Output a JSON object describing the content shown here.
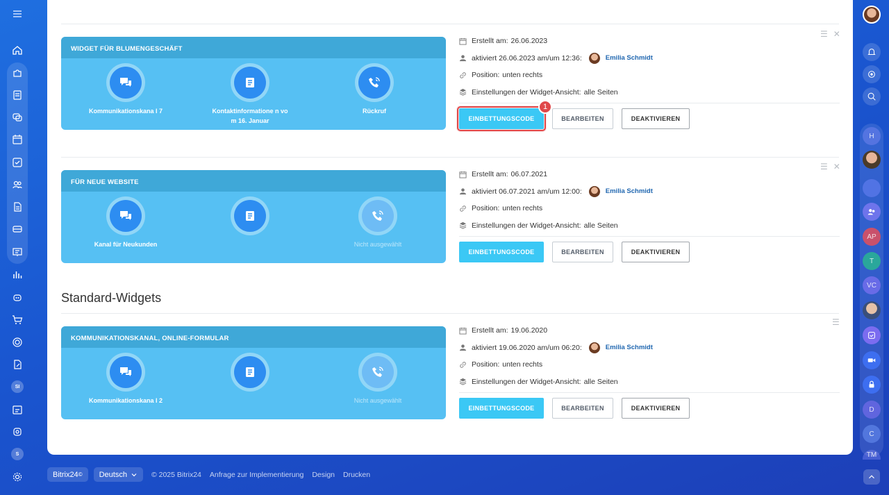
{
  "sidebar": {
    "icons": [
      "menu-icon",
      "home-icon",
      "puzzle-icon",
      "feed-icon",
      "chat-icon",
      "calendar-icon",
      "tasks-icon",
      "contacts-icon",
      "documents-icon",
      "inbox-icon",
      "presentation-icon",
      "analytics-icon",
      "robot-icon",
      "cart-icon",
      "target-icon",
      "edit-doc-icon"
    ],
    "badge_si": "SI",
    "badge_s": "S",
    "icons_bottom": [
      "calendar-list-icon",
      "support-icon",
      "settings-icon"
    ]
  },
  "rightbar": {
    "letters": [
      "H",
      "AP",
      "T",
      "VC",
      "D",
      "C",
      "TM"
    ]
  },
  "widgets": [
    {
      "title": "WIDGET FÜR BLUMENGESCHÄFT",
      "channels": [
        {
          "label": "Kommunikationskana l 7",
          "icon": "chat-icon",
          "active": true
        },
        {
          "label": "Kontaktinformatione n vom 16. Januar",
          "icon": "form-icon",
          "active": true
        },
        {
          "label": "Rückruf",
          "icon": "phone-icon",
          "active": true
        }
      ],
      "created_label": "Erstellt am:",
      "created": "26.06.2023",
      "activated_label": "aktiviert 26.06.2023 am/um 12:36:",
      "user": "Emilia Schmidt",
      "position_label": "Position:",
      "position": "unten rechts",
      "settings_label": "Einstellungen der Widget-Ansicht:",
      "settings": "alle Seiten",
      "btn_embed": "EINBETTUNGSCODE",
      "btn_edit": "BEARBEITEN",
      "btn_deactivate": "DEAKTIVIEREN",
      "callout": "1"
    },
    {
      "title": "FÜR NEUE WEBSITE",
      "channels": [
        {
          "label": "Kanal für Neukunden",
          "icon": "chat-icon",
          "active": true
        },
        {
          "label": "",
          "icon": "form-icon",
          "active": true
        },
        {
          "label": "Nicht ausgewählt",
          "icon": "phone-icon",
          "active": false
        }
      ],
      "created_label": "Erstellt am:",
      "created": "06.07.2021",
      "activated_label": "aktiviert 06.07.2021 am/um 12:00:",
      "user": "Emilia Schmidt",
      "position_label": "Position:",
      "position": "unten rechts",
      "settings_label": "Einstellungen der Widget-Ansicht:",
      "settings": "alle Seiten",
      "btn_embed": "EINBETTUNGSCODE",
      "btn_edit": "BEARBEITEN",
      "btn_deactivate": "DEAKTIVIEREN"
    },
    {
      "title": "KOMMUNIKATIONSKANAL, ONLINE-FORMULAR",
      "channels": [
        {
          "label": "Kommunikationskana l 2",
          "icon": "chat-icon",
          "active": true
        },
        {
          "label": "",
          "icon": "form-icon",
          "active": true
        },
        {
          "label": "Nicht ausgewählt",
          "icon": "phone-icon",
          "active": false
        }
      ],
      "created_label": "Erstellt am:",
      "created": "19.06.2020",
      "activated_label": "aktiviert 19.06.2020 am/um 06:20:",
      "user": "Emilia Schmidt",
      "position_label": "Position:",
      "position": "unten rechts",
      "settings_label": "Einstellungen der Widget-Ansicht:",
      "settings": "alle Seiten",
      "btn_embed": "EINBETTUNGSCODE",
      "btn_edit": "BEARBEITEN",
      "btn_deactivate": "DEAKTIVIEREN"
    }
  ],
  "section_standard": "Standard-Widgets",
  "footer": {
    "brand": "Bitrix24",
    "brand_mark": "©",
    "language": "Deutsch",
    "copyright": "© 2025 Bitrix24",
    "link_impl": "Anfrage zur Implementierung",
    "link_design": "Design",
    "link_print": "Drucken"
  },
  "colors": {
    "accent": "#3bc8f5",
    "card": "#56c0f3",
    "card_head": "#3fa8d8",
    "highlight": "#e0484a",
    "link": "#2067b0"
  }
}
